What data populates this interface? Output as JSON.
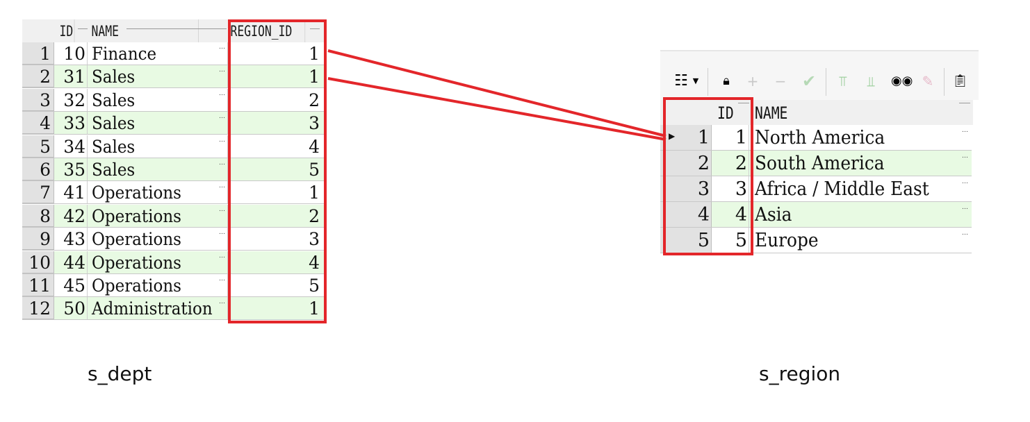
{
  "s_dept": {
    "caption": "s_dept",
    "columns": {
      "id": "ID",
      "name": "NAME",
      "region_id": "REGION_ID"
    },
    "rows": [
      {
        "num": "1",
        "id": "10",
        "name": "Finance",
        "region_id": "1"
      },
      {
        "num": "2",
        "id": "31",
        "name": "Sales",
        "region_id": "1"
      },
      {
        "num": "3",
        "id": "32",
        "name": "Sales",
        "region_id": "2"
      },
      {
        "num": "4",
        "id": "33",
        "name": "Sales",
        "region_id": "3"
      },
      {
        "num": "5",
        "id": "34",
        "name": "Sales",
        "region_id": "4"
      },
      {
        "num": "6",
        "id": "35",
        "name": "Sales",
        "region_id": "5"
      },
      {
        "num": "7",
        "id": "41",
        "name": "Operations",
        "region_id": "1"
      },
      {
        "num": "8",
        "id": "42",
        "name": "Operations",
        "region_id": "2"
      },
      {
        "num": "9",
        "id": "43",
        "name": "Operations",
        "region_id": "3"
      },
      {
        "num": "10",
        "id": "44",
        "name": "Operations",
        "region_id": "4"
      },
      {
        "num": "11",
        "id": "45",
        "name": "Operations",
        "region_id": "5"
      },
      {
        "num": "12",
        "id": "50",
        "name": "Administration",
        "region_id": "1"
      }
    ]
  },
  "s_region": {
    "caption": "s_region",
    "columns": {
      "id": "ID",
      "name": "NAME"
    },
    "rows": [
      {
        "num": "1",
        "id": "1",
        "name": "North America"
      },
      {
        "num": "2",
        "id": "2",
        "name": "South America"
      },
      {
        "num": "3",
        "id": "3",
        "name": "Africa / Middle East"
      },
      {
        "num": "4",
        "id": "4",
        "name": "Asia"
      },
      {
        "num": "5",
        "id": "5",
        "name": "Europe"
      }
    ],
    "toolbar": {
      "grid_menu_icon": "grid-icon",
      "lock_icon": "lock-icon",
      "add_icon": "plus-icon",
      "remove_icon": "minus-icon",
      "post_icon": "check-icon",
      "filter_icon": "filter-icon",
      "clear_filter_icon": "clear-filter-icon",
      "find_icon": "binoculars-icon",
      "clear_icon": "eraser-icon",
      "export_icon": "export-icon"
    }
  },
  "colors": {
    "highlight": "#e3262a",
    "alt_row": "#e8fae3",
    "row_header": "#e2e2e2"
  }
}
